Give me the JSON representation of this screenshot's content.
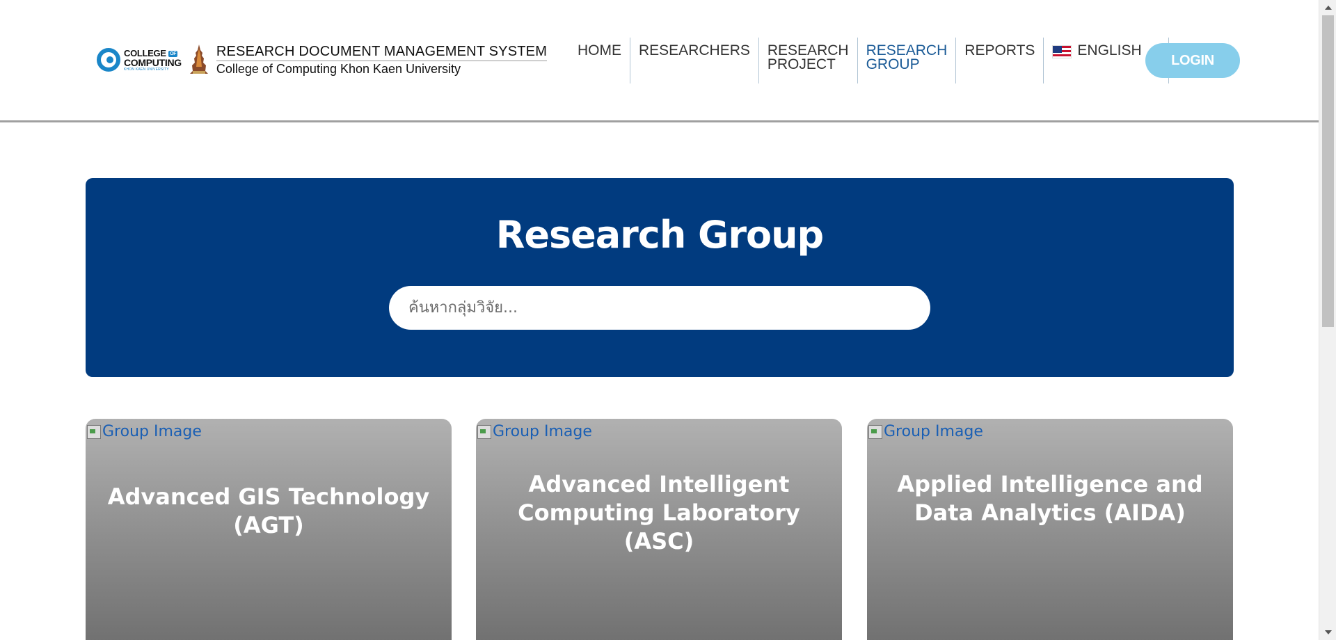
{
  "header": {
    "logo": {
      "college_line1": "COLLEGE",
      "college_of": "OF",
      "college_line2": "COMPUTING",
      "college_line3": "KHON KAEN UNIVERSITY"
    },
    "title": "RESEARCH DOCUMENT MANAGEMENT SYSTEM",
    "subtitle": "College of Computing Khon Kaen University",
    "nav": [
      {
        "line1": "HOME",
        "line2": ""
      },
      {
        "line1": "RESEARCHERS",
        "line2": ""
      },
      {
        "line1": "RESEARCH",
        "line2": "PROJECT"
      },
      {
        "line1": "RESEARCH",
        "line2": "GROUP",
        "active": true
      },
      {
        "line1": "REPORTS",
        "line2": ""
      }
    ],
    "language": "ENGLISH",
    "login_label": "LOGIN"
  },
  "banner": {
    "title": "Research Group",
    "search_placeholder": "ค้นหากลุ่มวิจัย..."
  },
  "cards": [
    {
      "image_alt": "Group Image",
      "title_line1": "Advanced GIS Technology",
      "title_line2": "(AGT)"
    },
    {
      "image_alt": "Group Image",
      "title_line1": "Advanced Intelligent",
      "title_line2": "Computing Laboratory (ASC)"
    },
    {
      "image_alt": "Group Image",
      "title_line1": "Applied Intelligence and",
      "title_line2": "Data Analytics (AIDA)"
    }
  ],
  "colors": {
    "banner_bg": "#013b7f",
    "active_nav": "#1a5a96",
    "login_bg": "#87ceeb",
    "link_blue": "#1a5fb4"
  }
}
